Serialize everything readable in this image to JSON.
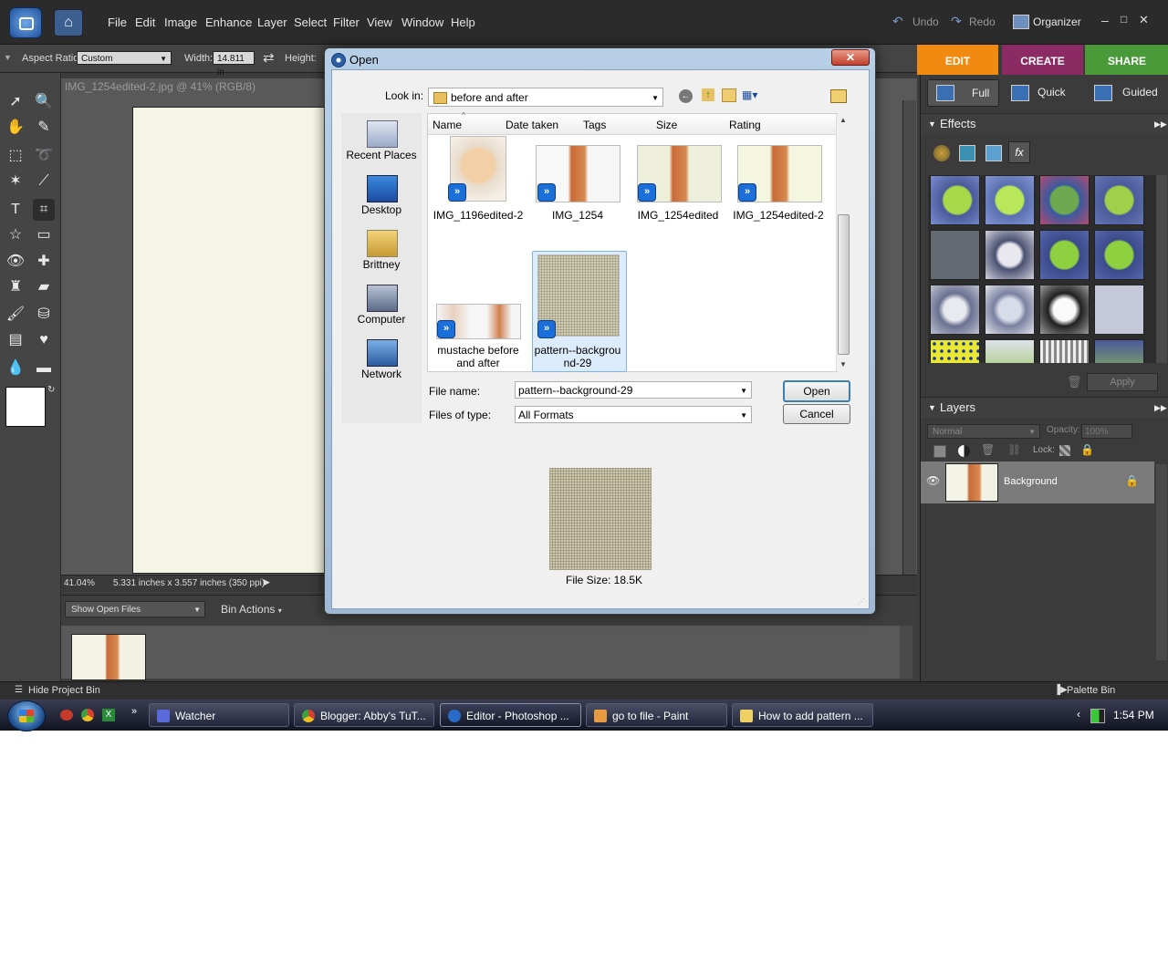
{
  "app": {
    "menu": [
      "File",
      "Edit",
      "Image",
      "Enhance",
      "Layer",
      "Select",
      "Filter",
      "View",
      "Window",
      "Help"
    ],
    "undo": "Undo",
    "redo": "Redo",
    "organizer": "Organizer"
  },
  "options_bar": {
    "aspect_label": "Aspect Ratio:",
    "aspect_value": "Custom",
    "width_label": "Width:",
    "width_value": "14.811 in",
    "height_label": "Height:"
  },
  "document": {
    "title": "IMG_1254edited-2.jpg @ 41% (RGB/8)",
    "zoom": "41.04%",
    "info": "5.331 inches x 3.557 inches (350 ppi)"
  },
  "project_bin": {
    "show_open_files": "Show Open Files",
    "bin_actions": "Bin Actions",
    "hide_label": "Hide Project Bin",
    "palette_bin": "Palette Bin"
  },
  "right_panel": {
    "tabs": [
      "EDIT",
      "CREATE",
      "SHARE"
    ],
    "tab_colors": [
      "#f08a10",
      "#8b2a63",
      "#4a9a3a"
    ],
    "modes": [
      "Full",
      "Quick",
      "Guided"
    ],
    "effects_title": "Effects",
    "apply": "Apply",
    "layers_title": "Layers",
    "blend_mode": "Normal",
    "opacity_label": "Opacity:",
    "opacity_value": "100%",
    "lock_label": "Lock:",
    "layer_name": "Background"
  },
  "dialog": {
    "title": "Open",
    "look_in_label": "Look in:",
    "look_in_value": "before and after",
    "columns": [
      "Name",
      "Date taken",
      "Tags",
      "Size",
      "Rating"
    ],
    "places": [
      "Recent Places",
      "Desktop",
      "Brittney",
      "Computer",
      "Network"
    ],
    "files_row1": [
      "IMG_1196edited-2",
      "IMG_1254",
      "IMG_1254edited",
      "IMG_1254edited-2"
    ],
    "file_mustache": [
      "mustache before",
      "and after"
    ],
    "file_pattern": [
      "pattern--backgrou",
      "nd-29"
    ],
    "file_name_label": "File name:",
    "file_name_value": "pattern--background-29",
    "file_type_label": "Files of type:",
    "file_type_value": "All Formats",
    "open_button": "Open",
    "cancel_button": "Cancel",
    "file_size": "File Size: 18.5K"
  },
  "taskbar": {
    "tasks": [
      "Watcher",
      "Blogger: Abby's TuT...",
      "Editor - Photoshop ...",
      "go to file - Paint",
      "How to add pattern ..."
    ],
    "time": "1:54 PM"
  }
}
